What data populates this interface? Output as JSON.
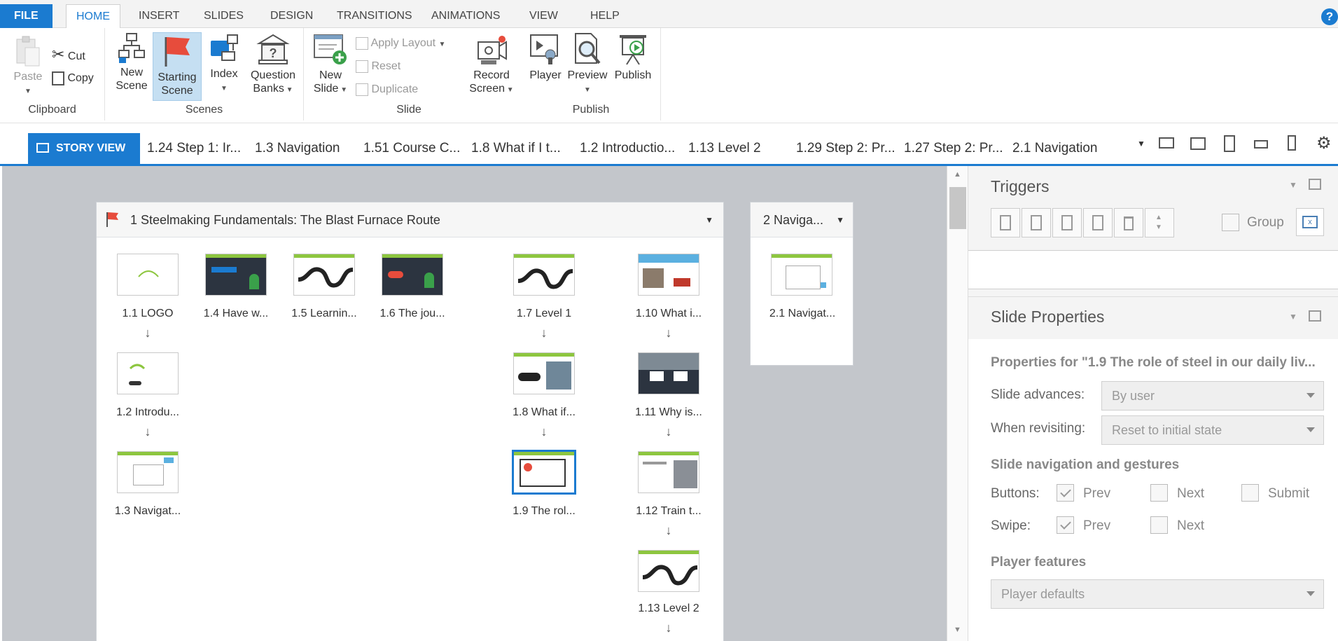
{
  "tabs": [
    "FILE",
    "HOME",
    "INSERT",
    "SLIDES",
    "DESIGN",
    "TRANSITIONS",
    "ANIMATIONS",
    "VIEW",
    "HELP"
  ],
  "help_label": "?",
  "ribbon": {
    "clipboard": {
      "paste": "Paste",
      "cut": "Cut",
      "copy": "Copy",
      "label": "Clipboard"
    },
    "scenes": {
      "new1": "New",
      "new2": "Scene",
      "start1": "Starting",
      "start2": "Scene",
      "index": "Index",
      "qb1": "Question",
      "qb2": "Banks",
      "label": "Scenes"
    },
    "slide": {
      "new1": "New",
      "new2": "Slide",
      "apply_layout": "Apply Layout",
      "reset": "Reset",
      "duplicate": "Duplicate",
      "rec1": "Record",
      "rec2": "Screen",
      "label": "Slide"
    },
    "publish": {
      "player": "Player",
      "preview": "Preview",
      "publish": "Publish",
      "label": "Publish"
    }
  },
  "viewbar": {
    "story_view": "STORY VIEW",
    "slide_tabs": [
      "1.24 Step 1: Ir...",
      "1.3 Navigation",
      "1.51 Course C...",
      "1.8 What if I t...",
      "1.2 Introductio...",
      "1.13 Level 2",
      "1.29 Step 2: Pr...",
      "1.27 Step 2: Pr...",
      "2.1 Navigation"
    ]
  },
  "scene1": {
    "title": "1 Steelmaking Fundamentals: The Blast Furnace Route",
    "slides": {
      "s11": "1.1 LOGO",
      "s14": "1.4 Have w...",
      "s15": "1.5 Learnin...",
      "s16": "1.6 The jou...",
      "s17": "1.7 Level 1",
      "s110": "1.10 What i...",
      "s12": "1.2 Introdu...",
      "s18": "1.8 What if...",
      "s111": "1.11 Why is...",
      "s13": "1.3 Navigat...",
      "s19": "1.9 The rol...",
      "s112": "1.12 Train t...",
      "s113": "1.13 Level 2"
    }
  },
  "scene2": {
    "title": "2 Naviga...",
    "slide": "2.1 Navigat..."
  },
  "panel": {
    "triggers_title": "Triggers",
    "group_label": "Group",
    "props_title": "Slide Properties",
    "props_for": "Properties for \"1.9 The role of steel in our daily liv...",
    "advances_label": "Slide advances:",
    "advances_value": "By user",
    "revisit_label": "When revisiting:",
    "revisit_value": "Reset to initial state",
    "nav_title": "Slide navigation and gestures",
    "buttons_label": "Buttons:",
    "swipe_label": "Swipe:",
    "prev": "Prev",
    "next": "Next",
    "submit": "Submit",
    "player_title": "Player features",
    "player_value": "Player defaults"
  },
  "colors": {
    "accent": "#1b7bd0",
    "canvas": "#c3c6cb",
    "green": "#8dc63f",
    "flag": "#e74c3c"
  }
}
